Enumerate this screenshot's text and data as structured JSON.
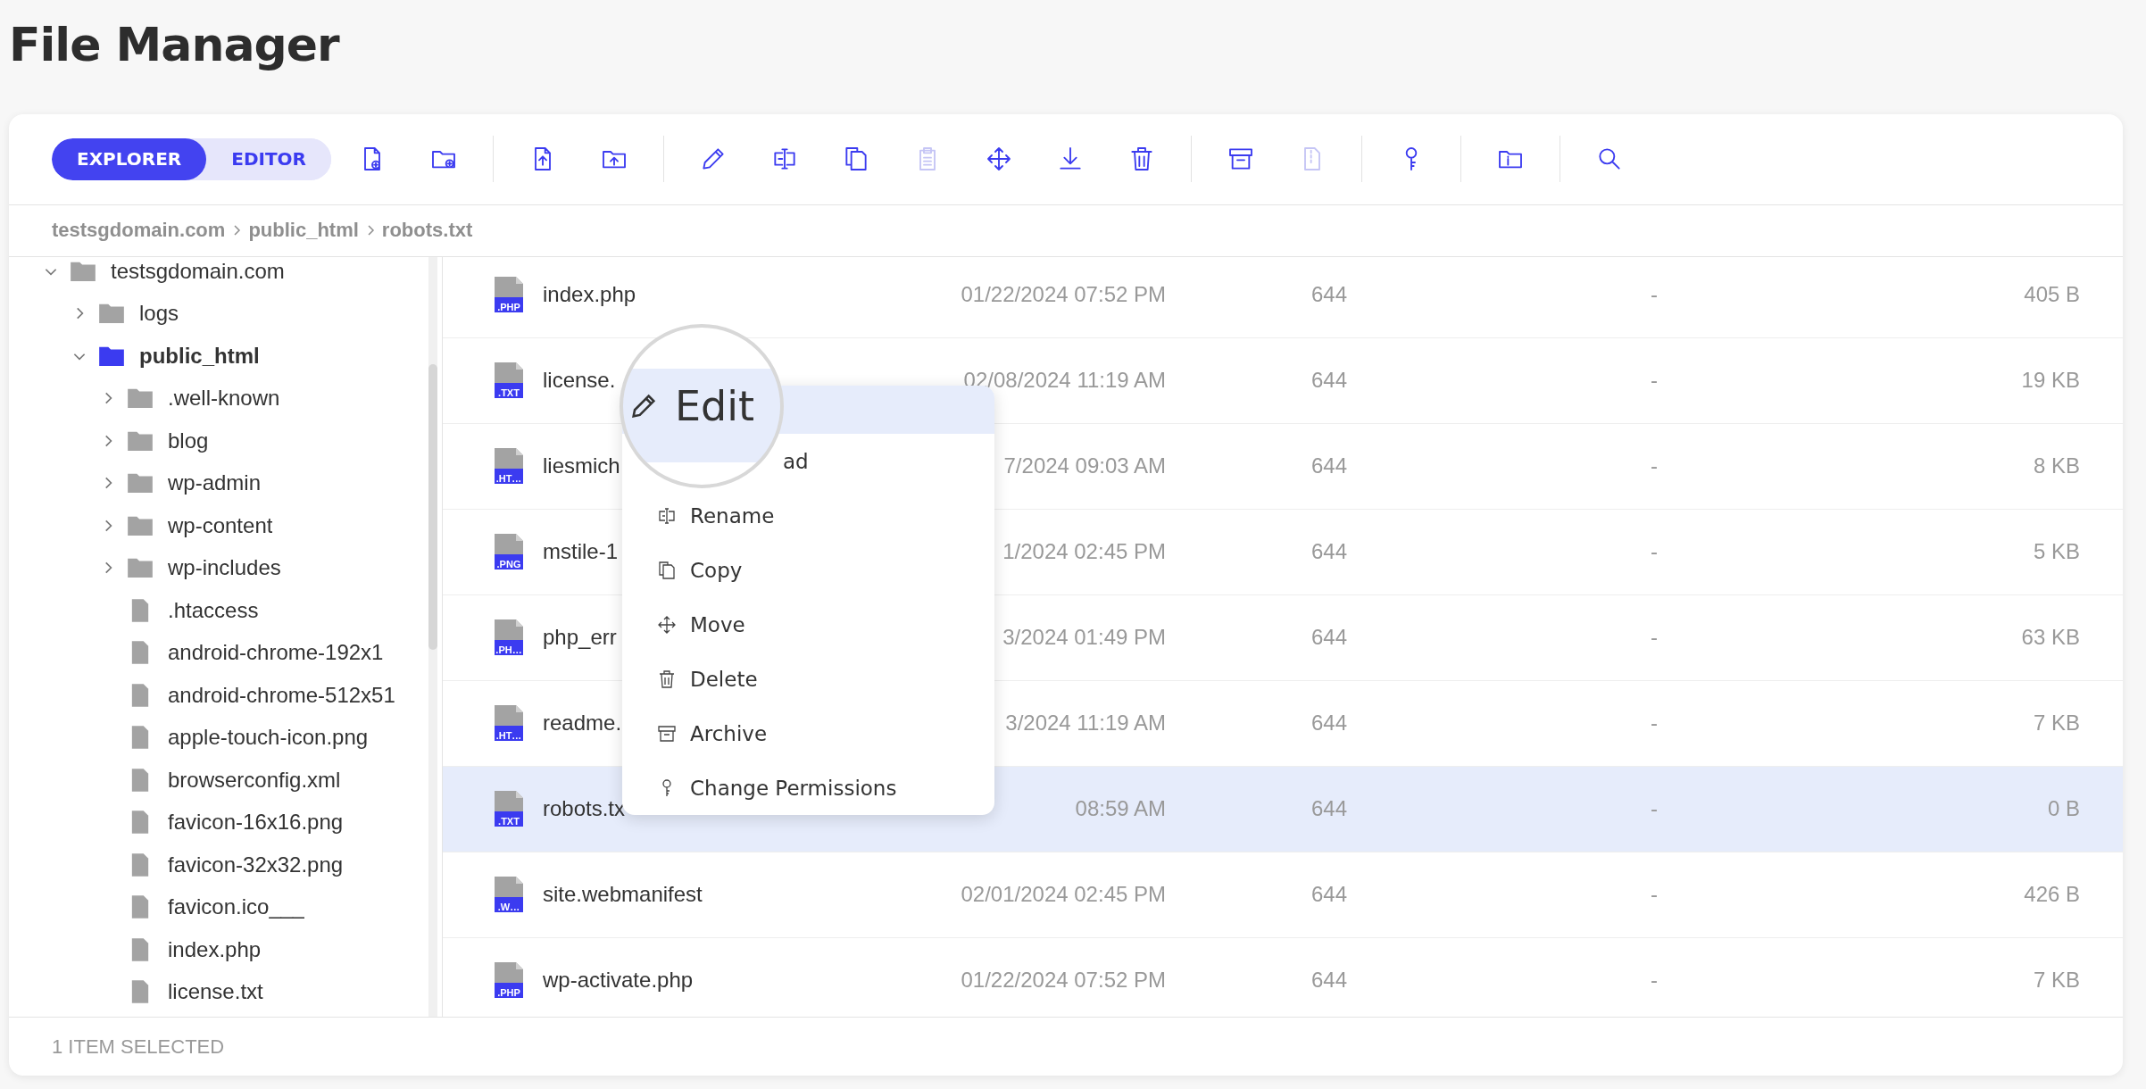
{
  "page_title": "File Manager",
  "toolbar": {
    "view_tabs": [
      {
        "label": "EXPLORER",
        "selected": true
      },
      {
        "label": "EDITOR",
        "selected": false
      }
    ],
    "tool_groups": [
      [
        {
          "kind": "new-file",
          "disabled": false
        },
        {
          "kind": "new-folder",
          "disabled": false
        }
      ],
      [
        {
          "kind": "upload-file",
          "disabled": false
        },
        {
          "kind": "upload-folder",
          "disabled": false
        }
      ],
      [
        {
          "kind": "edit",
          "disabled": false
        },
        {
          "kind": "rename",
          "disabled": false
        },
        {
          "kind": "copy",
          "disabled": false
        },
        {
          "kind": "paste",
          "disabled": true
        },
        {
          "kind": "move",
          "disabled": false
        },
        {
          "kind": "download",
          "disabled": false
        },
        {
          "kind": "delete",
          "disabled": false
        }
      ],
      [
        {
          "kind": "archive",
          "disabled": false
        },
        {
          "kind": "extract",
          "disabled": true
        }
      ],
      [
        {
          "kind": "permissions",
          "disabled": false
        }
      ],
      [
        {
          "kind": "info",
          "disabled": false
        }
      ],
      [
        {
          "kind": "search",
          "disabled": false
        }
      ]
    ]
  },
  "breadcrumb": [
    "testsgdomain.com",
    "public_html",
    "robots.txt"
  ],
  "tree": {
    "items": [
      {
        "label": "testsgdomain.com",
        "kind": "folder",
        "expanded": true,
        "selected": false,
        "children": [
          {
            "label": "logs",
            "kind": "folder",
            "expanded": false,
            "selected": false
          },
          {
            "label": "public_html",
            "kind": "folder",
            "expanded": true,
            "selected": true,
            "children": [
              {
                "label": ".well-known",
                "kind": "folder",
                "expanded": false,
                "selected": false
              },
              {
                "label": "blog",
                "kind": "folder",
                "expanded": false,
                "selected": false
              },
              {
                "label": "wp-admin",
                "kind": "folder",
                "expanded": false,
                "selected": false
              },
              {
                "label": "wp-content",
                "kind": "folder",
                "expanded": false,
                "selected": false
              },
              {
                "label": "wp-includes",
                "kind": "folder",
                "expanded": false,
                "selected": false
              },
              {
                "label": ".htaccess",
                "kind": "file",
                "selected": false
              },
              {
                "label": "android-chrome-192x1",
                "kind": "file",
                "selected": false
              },
              {
                "label": "android-chrome-512x51",
                "kind": "file",
                "selected": false
              },
              {
                "label": "apple-touch-icon.png",
                "kind": "file",
                "selected": false
              },
              {
                "label": "browserconfig.xml",
                "kind": "file",
                "selected": false
              },
              {
                "label": "favicon-16x16.png",
                "kind": "file",
                "selected": false
              },
              {
                "label": "favicon-32x32.png",
                "kind": "file",
                "selected": false
              },
              {
                "label": "favicon.ico___",
                "kind": "file",
                "selected": false
              },
              {
                "label": "index.php",
                "kind": "file",
                "selected": false
              },
              {
                "label": "license.txt",
                "kind": "file",
                "selected": false
              }
            ]
          }
        ]
      }
    ]
  },
  "table": {
    "rows": [
      {
        "name": "index.php",
        "ext": ".PHP",
        "date": "01/22/2024 07:52 PM",
        "permissions": "644",
        "column_4": "-",
        "size": "405 B",
        "selected": false
      },
      {
        "name": "license.",
        "ext": ".TXT",
        "date": "02/08/2024 11:19 AM",
        "permissions": "644",
        "column_4": "-",
        "size": "19 KB",
        "selected": false
      },
      {
        "name": "liesmich",
        "ext": ".HT…",
        "date": "7/2024 09:03 AM",
        "permissions": "644",
        "column_4": "-",
        "size": "8 KB",
        "selected": false
      },
      {
        "name": "mstile-1",
        "ext": ".PNG",
        "date": "1/2024 02:45 PM",
        "permissions": "644",
        "column_4": "-",
        "size": "5 KB",
        "selected": false
      },
      {
        "name": "php_err",
        "ext": ".PH…",
        "date": "3/2024 01:49 PM",
        "permissions": "644",
        "column_4": "-",
        "size": "63 KB",
        "selected": false
      },
      {
        "name": "readme.",
        "ext": ".HT…",
        "date": "3/2024 11:19 AM",
        "permissions": "644",
        "column_4": "-",
        "size": "7 KB",
        "selected": false
      },
      {
        "name": "robots.tx",
        "ext": ".TXT",
        "date": "08:59 AM",
        "permissions": "644",
        "column_4": "-",
        "size": "0 B",
        "selected": true
      },
      {
        "name": "site.webmanifest",
        "ext": ".W…",
        "date": "02/01/2024 02:45 PM",
        "permissions": "644",
        "column_4": "-",
        "size": "426 B",
        "selected": false
      },
      {
        "name": "wp-activate.php",
        "ext": ".PHP",
        "date": "01/22/2024 07:52 PM",
        "permissions": "644",
        "column_4": "-",
        "size": "7 KB",
        "selected": false
      }
    ]
  },
  "context_menu": {
    "items": [
      {
        "kind": "edit",
        "label": "Edit",
        "selected": true,
        "covered": false
      },
      {
        "kind": "download",
        "label": "ad",
        "selected": false,
        "covered": true
      },
      {
        "kind": "rename",
        "label": "Rename",
        "selected": false,
        "covered": false
      },
      {
        "kind": "copy",
        "label": "Copy",
        "selected": false,
        "covered": false
      },
      {
        "kind": "move",
        "label": "Move",
        "selected": false,
        "covered": false
      },
      {
        "kind": "delete",
        "label": "Delete",
        "selected": false,
        "covered": false
      },
      {
        "kind": "archive",
        "label": "Archive",
        "selected": false,
        "covered": false
      },
      {
        "kind": "permissions",
        "label": "Change Permissions",
        "selected": false,
        "covered": false
      }
    ]
  },
  "status_bar": "1 ITEM SELECTED"
}
